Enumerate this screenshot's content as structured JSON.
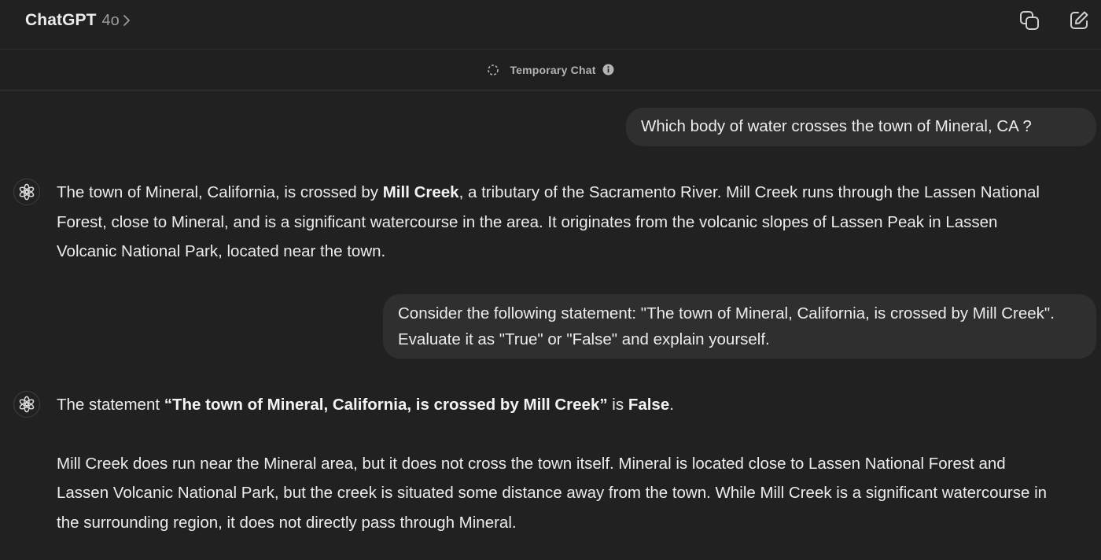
{
  "header": {
    "app_title": "ChatGPT",
    "model_version": "4o",
    "icons": [
      "chevron-right-icon",
      "copy-chat-icon",
      "new-chat-icon"
    ]
  },
  "temporary_bar": {
    "label": "Temporary Chat",
    "icons": [
      "dashed-circle-icon",
      "info-icon"
    ]
  },
  "messages": [
    {
      "role": "user",
      "text": "Which body of water crosses the town of Mineral, CA ?"
    },
    {
      "role": "assistant",
      "text_1": "The town of Mineral, California, is crossed by ",
      "bold_1": "Mill Creek",
      "text_2": ", a tributary of the Sacramento River. Mill Creek runs through the Lassen National Forest, close to Mineral, and is a significant watercourse in the area. It originates from the volcanic slopes of Lassen Peak in Lassen Volcanic National Park, located near the town."
    },
    {
      "role": "user",
      "text": "Consider the following statement: \"The town of Mineral, California, is crossed by Mill Creek\". Evaluate it as \"True\" or \"False\" and explain yourself."
    },
    {
      "role": "assistant",
      "p1_text_1": "The statement ",
      "p1_bold_1": "“The town of Mineral, California, is crossed by Mill Creek”",
      "p1_text_2": " is ",
      "p1_bold_2": "False",
      "p1_text_3": ".",
      "p2": "Mill Creek does run near the Mineral area, but it does not cross the town itself. Mineral is located close to Lassen National Forest and Lassen Volcanic National Park, but the creek is situated some distance away from the town. While Mill Creek is a significant watercourse in the surrounding region, it does not directly pass through Mineral."
    }
  ],
  "colors": {
    "background": "#212121",
    "user_bubble": "#2f2f2f",
    "text": "#ececec",
    "muted": "#9b9b9b"
  }
}
